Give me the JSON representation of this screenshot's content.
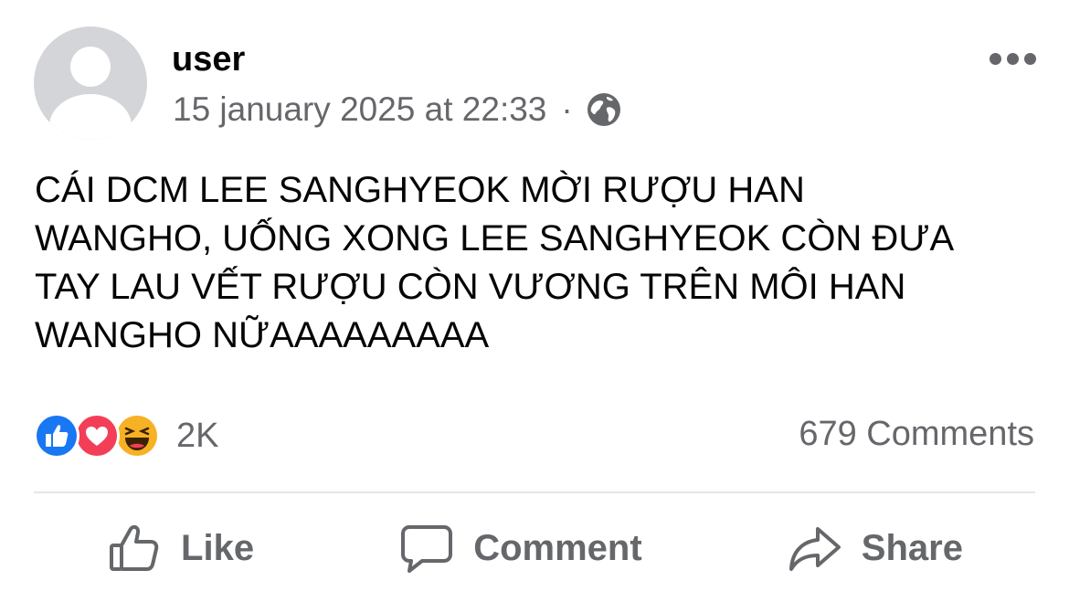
{
  "post": {
    "author": "user",
    "timestamp": "15 january 2025 at 22:33",
    "separator": "·",
    "privacy_icon": "globe-icon",
    "text": "CÁI DCM LEE SANGHYEOK MỜI RƯỢU HAN\nWANGHO, UỐNG XONG LEE SANGHYEOK CÒN ĐƯA\nTAY LAU VẾT RƯỢU CÒN VƯƠNG TRÊN MÔI HAN\nWANGHO NỮAAAAAAAAA",
    "reactions": {
      "icons": [
        "like-icon",
        "love-icon",
        "haha-icon"
      ],
      "count": "2K"
    },
    "comments_count": "679 Comments",
    "actions": {
      "like": "Like",
      "comment": "Comment",
      "share": "Share"
    }
  },
  "colors": {
    "text_primary": "#050505",
    "text_secondary": "#65676b",
    "like_blue": "#1877f2",
    "love_red": "#f33e58",
    "haha_yellow": "#f7b125",
    "divider": "#e4e6eb"
  }
}
